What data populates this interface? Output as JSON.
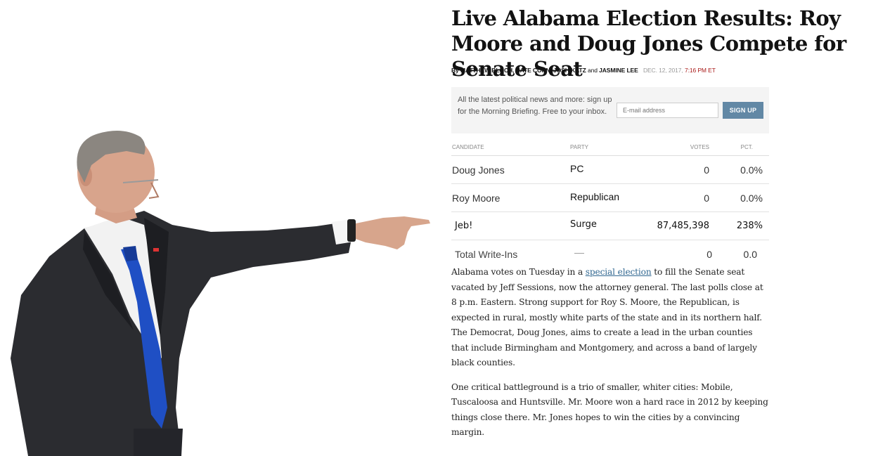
{
  "article": {
    "headline": "Live Alabama Election Results: Roy Moore and Doug Jones Compete for Senate Seat",
    "byline": {
      "by": "By ",
      "names": "Matthew Bloch, Nate Cohn, Josh Katz",
      "and": " and ",
      "last_name": "Jasmine Lee",
      "date": "Dec. 12, 2017, ",
      "time": "7:16 PM ET"
    },
    "signup": {
      "text": "All the latest political news and more: sign up for the Morning Briefing. Free to your inbox.",
      "placeholder": "E-mail address",
      "button": "SIGN UP"
    },
    "results": {
      "headers": {
        "candidate": "CANDIDATE",
        "party": "PARTY",
        "votes": "VOTES",
        "pct": "PCT."
      },
      "rows": [
        {
          "candidate": "Doug Jones",
          "party": "PC",
          "votes": "0",
          "pct": "0.0%"
        },
        {
          "candidate": "Roy Moore",
          "party": "Republican",
          "votes": "0",
          "pct": "0.0%"
        },
        {
          "candidate": "Jeb!",
          "party": "Surge",
          "votes": "87,485,398",
          "pct": "238%"
        },
        {
          "candidate": "Total Write-Ins",
          "party": "—",
          "votes": "0",
          "pct": "0.0"
        }
      ]
    },
    "paragraph1": {
      "before_link": "Alabama votes on Tuesday in a ",
      "link": "special election",
      "after_link": " to fill the Senate seat vacated by Jeff Sessions, now the attorney general. The last polls close at 8 p.m. Eastern. Strong support for Roy S. Moore, the Republican, is expected in rural, mostly white parts of the state and in its northern half. The Democrat, Doug Jones, aims to create a lead in the urban counties that include Birmingham and Montgomery, and across a band of largely black counties."
    },
    "paragraph2": "One critical battleground is a trio of smaller, whiter cities: Mobile, Tuscaloosa and Huntsville. Mr. Moore won a hard race in 2012 by keeping things close there. Mr. Jones hopes to win the cities by a convincing margin."
  },
  "colors": {
    "suit": "#2b2c30",
    "tie": "#1f4fc4",
    "button": "#6288a5",
    "link": "#326891",
    "time": "#a81817"
  }
}
